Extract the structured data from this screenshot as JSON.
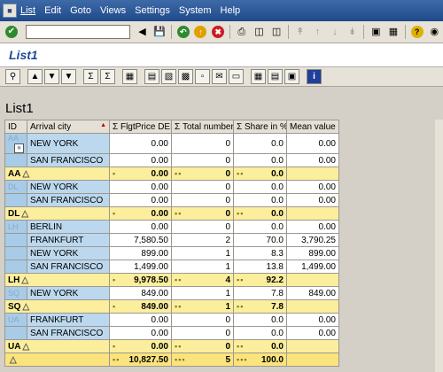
{
  "menu": {
    "items": [
      "List",
      "Edit",
      "Goto",
      "Views",
      "Settings",
      "System",
      "Help"
    ]
  },
  "system_toolbar": {
    "command_field_value": ""
  },
  "screen": {
    "title": "List1"
  },
  "list": {
    "title": "List1",
    "columns": [
      "ID",
      "Arrival city",
      "Σ FlgtPrice DEM",
      "Σ Total number",
      "Σ Share in %",
      "Mean value"
    ],
    "groups": [
      {
        "id": "AA",
        "rows": [
          {
            "city": "NEW YORK",
            "price": "0.00",
            "total": "0",
            "share": "0.0",
            "mean": "0.00"
          },
          {
            "city": "SAN FRANCISCO",
            "price": "0.00",
            "total": "0",
            "share": "0.0",
            "mean": "0.00"
          }
        ],
        "subtotal": {
          "label": "AA",
          "price": "0.00",
          "total": "0",
          "share": "0.0"
        }
      },
      {
        "id": "DL",
        "rows": [
          {
            "city": "NEW YORK",
            "price": "0.00",
            "total": "0",
            "share": "0.0",
            "mean": "0.00"
          },
          {
            "city": "SAN FRANCISCO",
            "price": "0.00",
            "total": "0",
            "share": "0.0",
            "mean": "0.00"
          }
        ],
        "subtotal": {
          "label": "DL",
          "price": "0.00",
          "total": "0",
          "share": "0.0"
        }
      },
      {
        "id": "LH",
        "rows": [
          {
            "city": "BERLIN",
            "price": "0.00",
            "total": "0",
            "share": "0.0",
            "mean": "0.00"
          },
          {
            "city": "FRANKFURT",
            "price": "7,580.50",
            "total": "2",
            "share": "70.0",
            "mean": "3,790.25"
          },
          {
            "city": "NEW YORK",
            "price": "899.00",
            "total": "1",
            "share": "8.3",
            "mean": "899.00"
          },
          {
            "city": "SAN FRANCISCO",
            "price": "1,499.00",
            "total": "1",
            "share": "13.8",
            "mean": "1,499.00"
          }
        ],
        "subtotal": {
          "label": "LH",
          "price": "9,978.50",
          "total": "4",
          "share": "92.2"
        }
      },
      {
        "id": "SQ",
        "rows": [
          {
            "city": "NEW YORK",
            "price": "849.00",
            "total": "1",
            "share": "7.8",
            "mean": "849.00"
          }
        ],
        "subtotal": {
          "label": "SQ",
          "price": "849.00",
          "total": "1",
          "share": "7.8"
        }
      },
      {
        "id": "UA",
        "rows": [
          {
            "city": "FRANKFURT",
            "price": "0.00",
            "total": "0",
            "share": "0.0",
            "mean": "0.00"
          },
          {
            "city": "SAN FRANCISCO",
            "price": "0.00",
            "total": "0",
            "share": "0.0",
            "mean": "0.00"
          }
        ],
        "subtotal": {
          "label": "UA",
          "price": "0.00",
          "total": "0",
          "share": "0.0"
        }
      }
    ],
    "grand_total": {
      "price": "10,827.50",
      "total": "5",
      "share": "100.0"
    }
  },
  "icons": {
    "ok": "enter-icon",
    "save": "save-icon",
    "back": "back-icon",
    "exit": "exit-icon",
    "cancel": "cancel-icon",
    "print": "print-icon",
    "help": "help-icon"
  },
  "colors": {
    "menubar": "#2f5a98",
    "title": "#1f4a9a",
    "key_cell": "#a8cce8",
    "subtotal_row": "#fbee9c",
    "total_row": "#fbe37e"
  }
}
